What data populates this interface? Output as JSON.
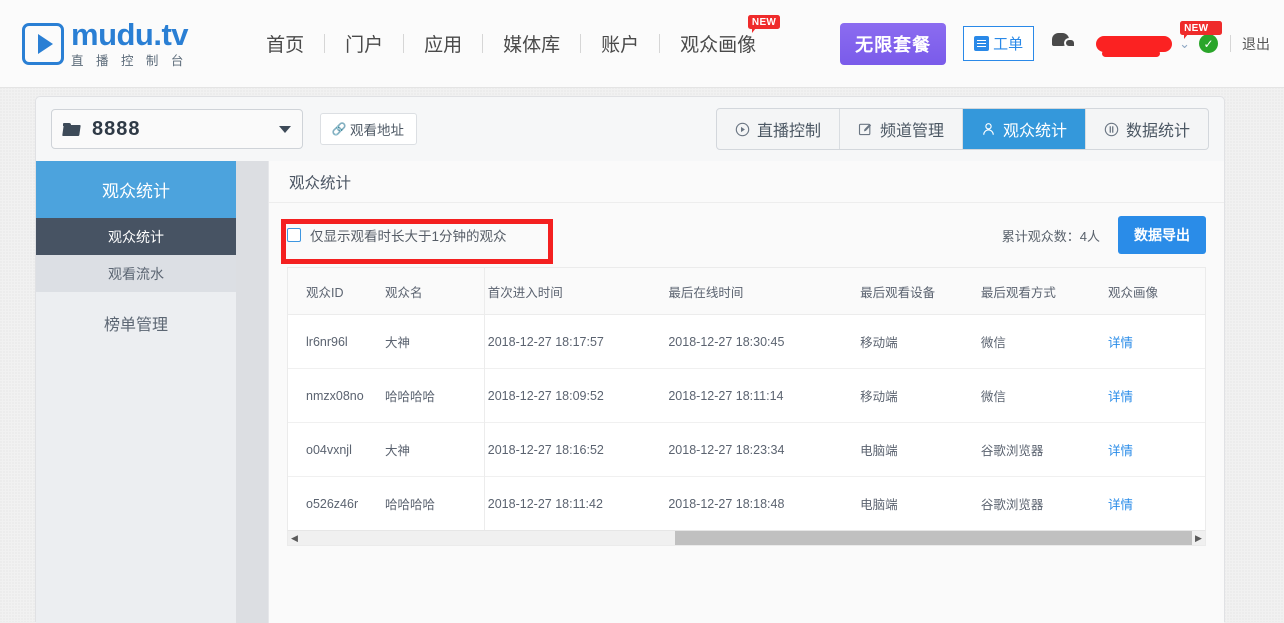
{
  "header": {
    "logo_main": "mudu.tv",
    "logo_sub": "直 播 控 制 台",
    "nav": [
      {
        "label": "首页",
        "badge": ""
      },
      {
        "label": "门户",
        "badge": ""
      },
      {
        "label": "应用",
        "badge": ""
      },
      {
        "label": "媒体库",
        "badge": ""
      },
      {
        "label": "账户",
        "badge": ""
      },
      {
        "label": "观众画像",
        "badge": "NEW"
      }
    ],
    "plan_button": "无限套餐",
    "ticket_button": "工单",
    "user_badge": "NEW",
    "logout": "退出",
    "icons": {
      "chat": "chat-bubbles-icon",
      "doc": "document-list-icon",
      "verified": "✓",
      "chevron": "⌄"
    }
  },
  "toolbar": {
    "channel_name": "8888",
    "watch_address_button": "观看地址",
    "tabs": [
      {
        "label": "直播控制",
        "icon": "play-circle-icon",
        "active": false
      },
      {
        "label": "频道管理",
        "icon": "edit-square-icon",
        "active": false
      },
      {
        "label": "观众统计",
        "icon": "user-icon",
        "active": true
      },
      {
        "label": "数据统计",
        "icon": "chart-pie-icon",
        "active": false
      }
    ]
  },
  "sidebar": {
    "group_title": "观众统计",
    "items": [
      {
        "label": "观众统计",
        "selected": true
      },
      {
        "label": "观看流水",
        "selected": false
      }
    ],
    "group2_title": "榜单管理"
  },
  "content": {
    "panel_title": "观众统计",
    "filter_checkbox_label": "仅显示观看时长大于1分钟的观众",
    "filter_checked": false,
    "count_text": "累计观众数：4人",
    "export_button": "数据导出",
    "columns": [
      "观众ID",
      "观众名",
      "首次进入时间",
      "最后在线时间",
      "最后观看设备",
      "最后观看方式",
      "观众画像"
    ],
    "rows": [
      {
        "id": "lr6nr96l",
        "name": "大神",
        "first_enter": "2018-12-27 18:17:57",
        "last_online": "2018-12-27 18:30:45",
        "device": "移动端",
        "method": "微信",
        "portrait": "详情"
      },
      {
        "id": "nmzx08no",
        "name": "哈哈哈哈",
        "first_enter": "2018-12-27 18:09:52",
        "last_online": "2018-12-27 18:11:14",
        "device": "移动端",
        "method": "微信",
        "portrait": "详情"
      },
      {
        "id": "o04vxnjl",
        "name": "大神",
        "first_enter": "2018-12-27 18:16:52",
        "last_online": "2018-12-27 18:23:34",
        "device": "电脑端",
        "method": "谷歌浏览器",
        "portrait": "详情"
      },
      {
        "id": "o526z46r",
        "name": "哈哈哈哈",
        "first_enter": "2018-12-27 18:11:42",
        "last_online": "2018-12-27 18:18:48",
        "device": "电脑端",
        "method": "谷歌浏览器",
        "portrait": "详情"
      }
    ],
    "scroll_left_arrow": "◀",
    "scroll_right_arrow": "▶"
  },
  "colors": {
    "brand_blue": "#2a7fd4",
    "tab_active": "#3498db",
    "sidebar_head": "#4ca3dd",
    "sidebar_selected": "#475363",
    "export_blue": "#2a8ce8",
    "plan_purple": "#7a5bea",
    "badge_red": "#ef2b2b",
    "annotation_red": "#f42020",
    "link_blue": "#2a8ce8"
  }
}
